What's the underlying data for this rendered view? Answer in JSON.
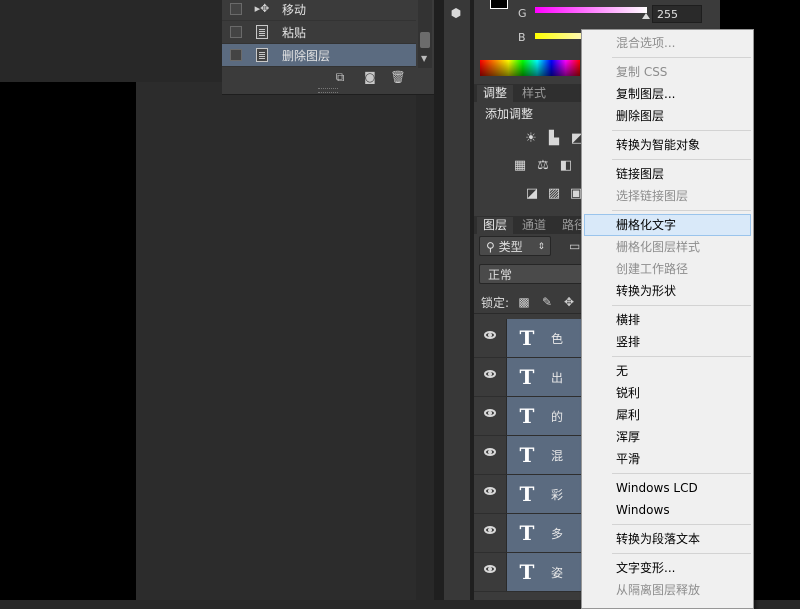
{
  "history": {
    "items": [
      {
        "label": "移动",
        "icon": "move-icon"
      },
      {
        "label": "粘贴",
        "icon": "document-icon"
      },
      {
        "label": "删除图层",
        "icon": "document-icon",
        "selected": true
      }
    ],
    "toolbar": [
      "new-document-from-state-icon",
      "camera-snapshot-icon",
      "trash-icon"
    ]
  },
  "color_panel": {
    "channel_g_label": "G",
    "channel_b_label": "B",
    "g_value": "255",
    "colors": {
      "g_start": "#ff00ff",
      "b_start": "#ffff00"
    }
  },
  "adjustments": {
    "tabs": [
      "调整",
      "样式"
    ],
    "title": "添加调整",
    "icons_row1": [
      "brightness-icon",
      "levels-icon",
      "curves-icon"
    ],
    "icons_row2": [
      "hue-saturation-icon",
      "color-balance-icon",
      "black-white-icon"
    ],
    "icons_row3": [
      "invert-icon",
      "gradient-map-icon",
      "selective-color-icon"
    ]
  },
  "layers": {
    "tabs": [
      "图层",
      "通道",
      "路径"
    ],
    "filter_kind": "类型",
    "blend_mode": "正常",
    "lock_label": "锁定:",
    "items": [
      {
        "thumb": "T",
        "name": "色"
      },
      {
        "thumb": "T",
        "name": "出"
      },
      {
        "thumb": "T",
        "name": "的"
      },
      {
        "thumb": "T",
        "name": "混"
      },
      {
        "thumb": "T",
        "name": "彩"
      },
      {
        "thumb": "T",
        "name": "多"
      },
      {
        "thumb": "T",
        "name": "姿"
      }
    ],
    "selected_color": "#5b6b80"
  },
  "context_menu": {
    "items": [
      {
        "label": "混合选项...",
        "disabled": true
      },
      {
        "sep": true
      },
      {
        "label": "复制 CSS",
        "disabled": true
      },
      {
        "label": "复制图层..."
      },
      {
        "label": "删除图层"
      },
      {
        "sep": true
      },
      {
        "label": "转换为智能对象"
      },
      {
        "sep": true
      },
      {
        "label": "链接图层"
      },
      {
        "label": "选择链接图层",
        "disabled": true
      },
      {
        "sep": true
      },
      {
        "label": "栅格化文字",
        "hover": true
      },
      {
        "label": "栅格化图层样式",
        "disabled": true
      },
      {
        "label": "创建工作路径",
        "disabled": true
      },
      {
        "label": "转换为形状"
      },
      {
        "sep": true
      },
      {
        "label": "横排"
      },
      {
        "label": "竖排"
      },
      {
        "sep": true
      },
      {
        "label": "无"
      },
      {
        "label": "锐利"
      },
      {
        "label": "犀利"
      },
      {
        "label": "浑厚"
      },
      {
        "label": "平滑"
      },
      {
        "sep": true
      },
      {
        "label": "Windows LCD"
      },
      {
        "label": "Windows"
      },
      {
        "sep": true
      },
      {
        "label": "转换为段落文本"
      },
      {
        "sep": true
      },
      {
        "label": "文字变形..."
      },
      {
        "label": "从隔离图层释放",
        "disabled": true
      }
    ]
  }
}
